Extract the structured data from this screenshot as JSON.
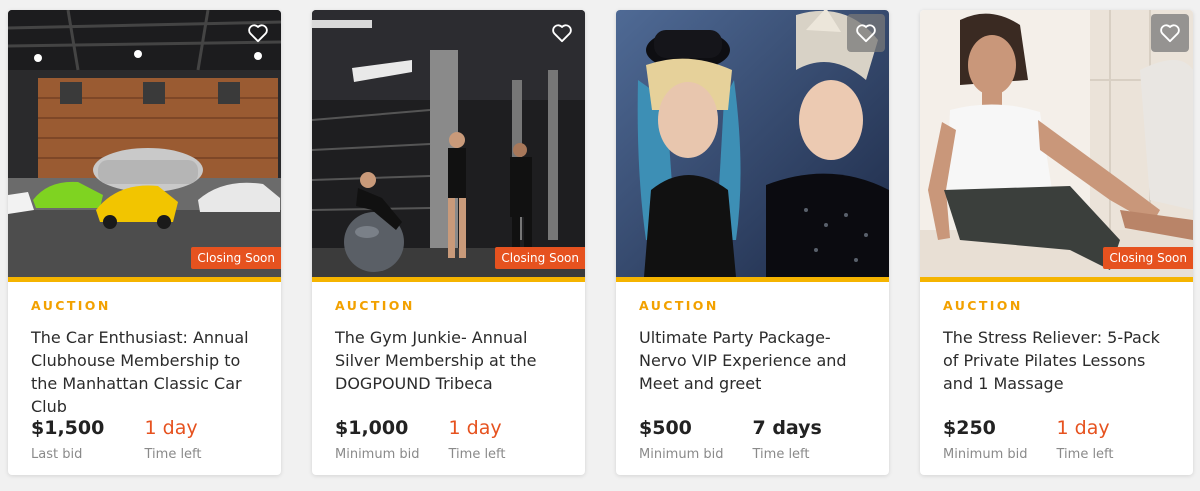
{
  "colors": {
    "accent_bar": "#f5b400",
    "type_label": "#f2a100",
    "badge_bg": "#e6521f",
    "urgent_text": "#e6521f"
  },
  "cards": [
    {
      "image": "car-garage-photo",
      "favorite_icon": "heart-outline-icon",
      "badge": "Closing Soon",
      "type": "AUCTION",
      "title": "The Car Enthusiast: Annual Clubhouse Membership to the Manhattan Classic Car Club",
      "price": "$1,500",
      "price_label": "Last bid",
      "time": "1 day",
      "time_label": "Time left"
    },
    {
      "image": "gym-photo",
      "favorite_icon": "heart-outline-icon",
      "badge": "Closing Soon",
      "type": "AUCTION",
      "title": "The Gym Junkie- Annual Silver Membership at the DOGPOUND Tribeca",
      "price": "$1,000",
      "price_label": "Minimum bid",
      "time": "1 day",
      "time_label": "Time left"
    },
    {
      "image": "nervo-duo-photo",
      "favorite_icon": "heart-outline-icon",
      "badge": "",
      "type": "AUCTION",
      "title": "Ultimate Party Package- Nervo VIP Experience and Meet and greet",
      "price": "$500",
      "price_label": "Minimum bid",
      "time": "7 days",
      "time_label": "Time left"
    },
    {
      "image": "pilates-photo",
      "favorite_icon": "heart-outline-icon",
      "badge": "Closing Soon",
      "type": "AUCTION",
      "title": "The Stress Reliever: 5-Pack of Private Pilates Lessons and 1 Massage",
      "price": "$250",
      "price_label": "Minimum bid",
      "time": "1 day",
      "time_label": "Time left"
    }
  ]
}
